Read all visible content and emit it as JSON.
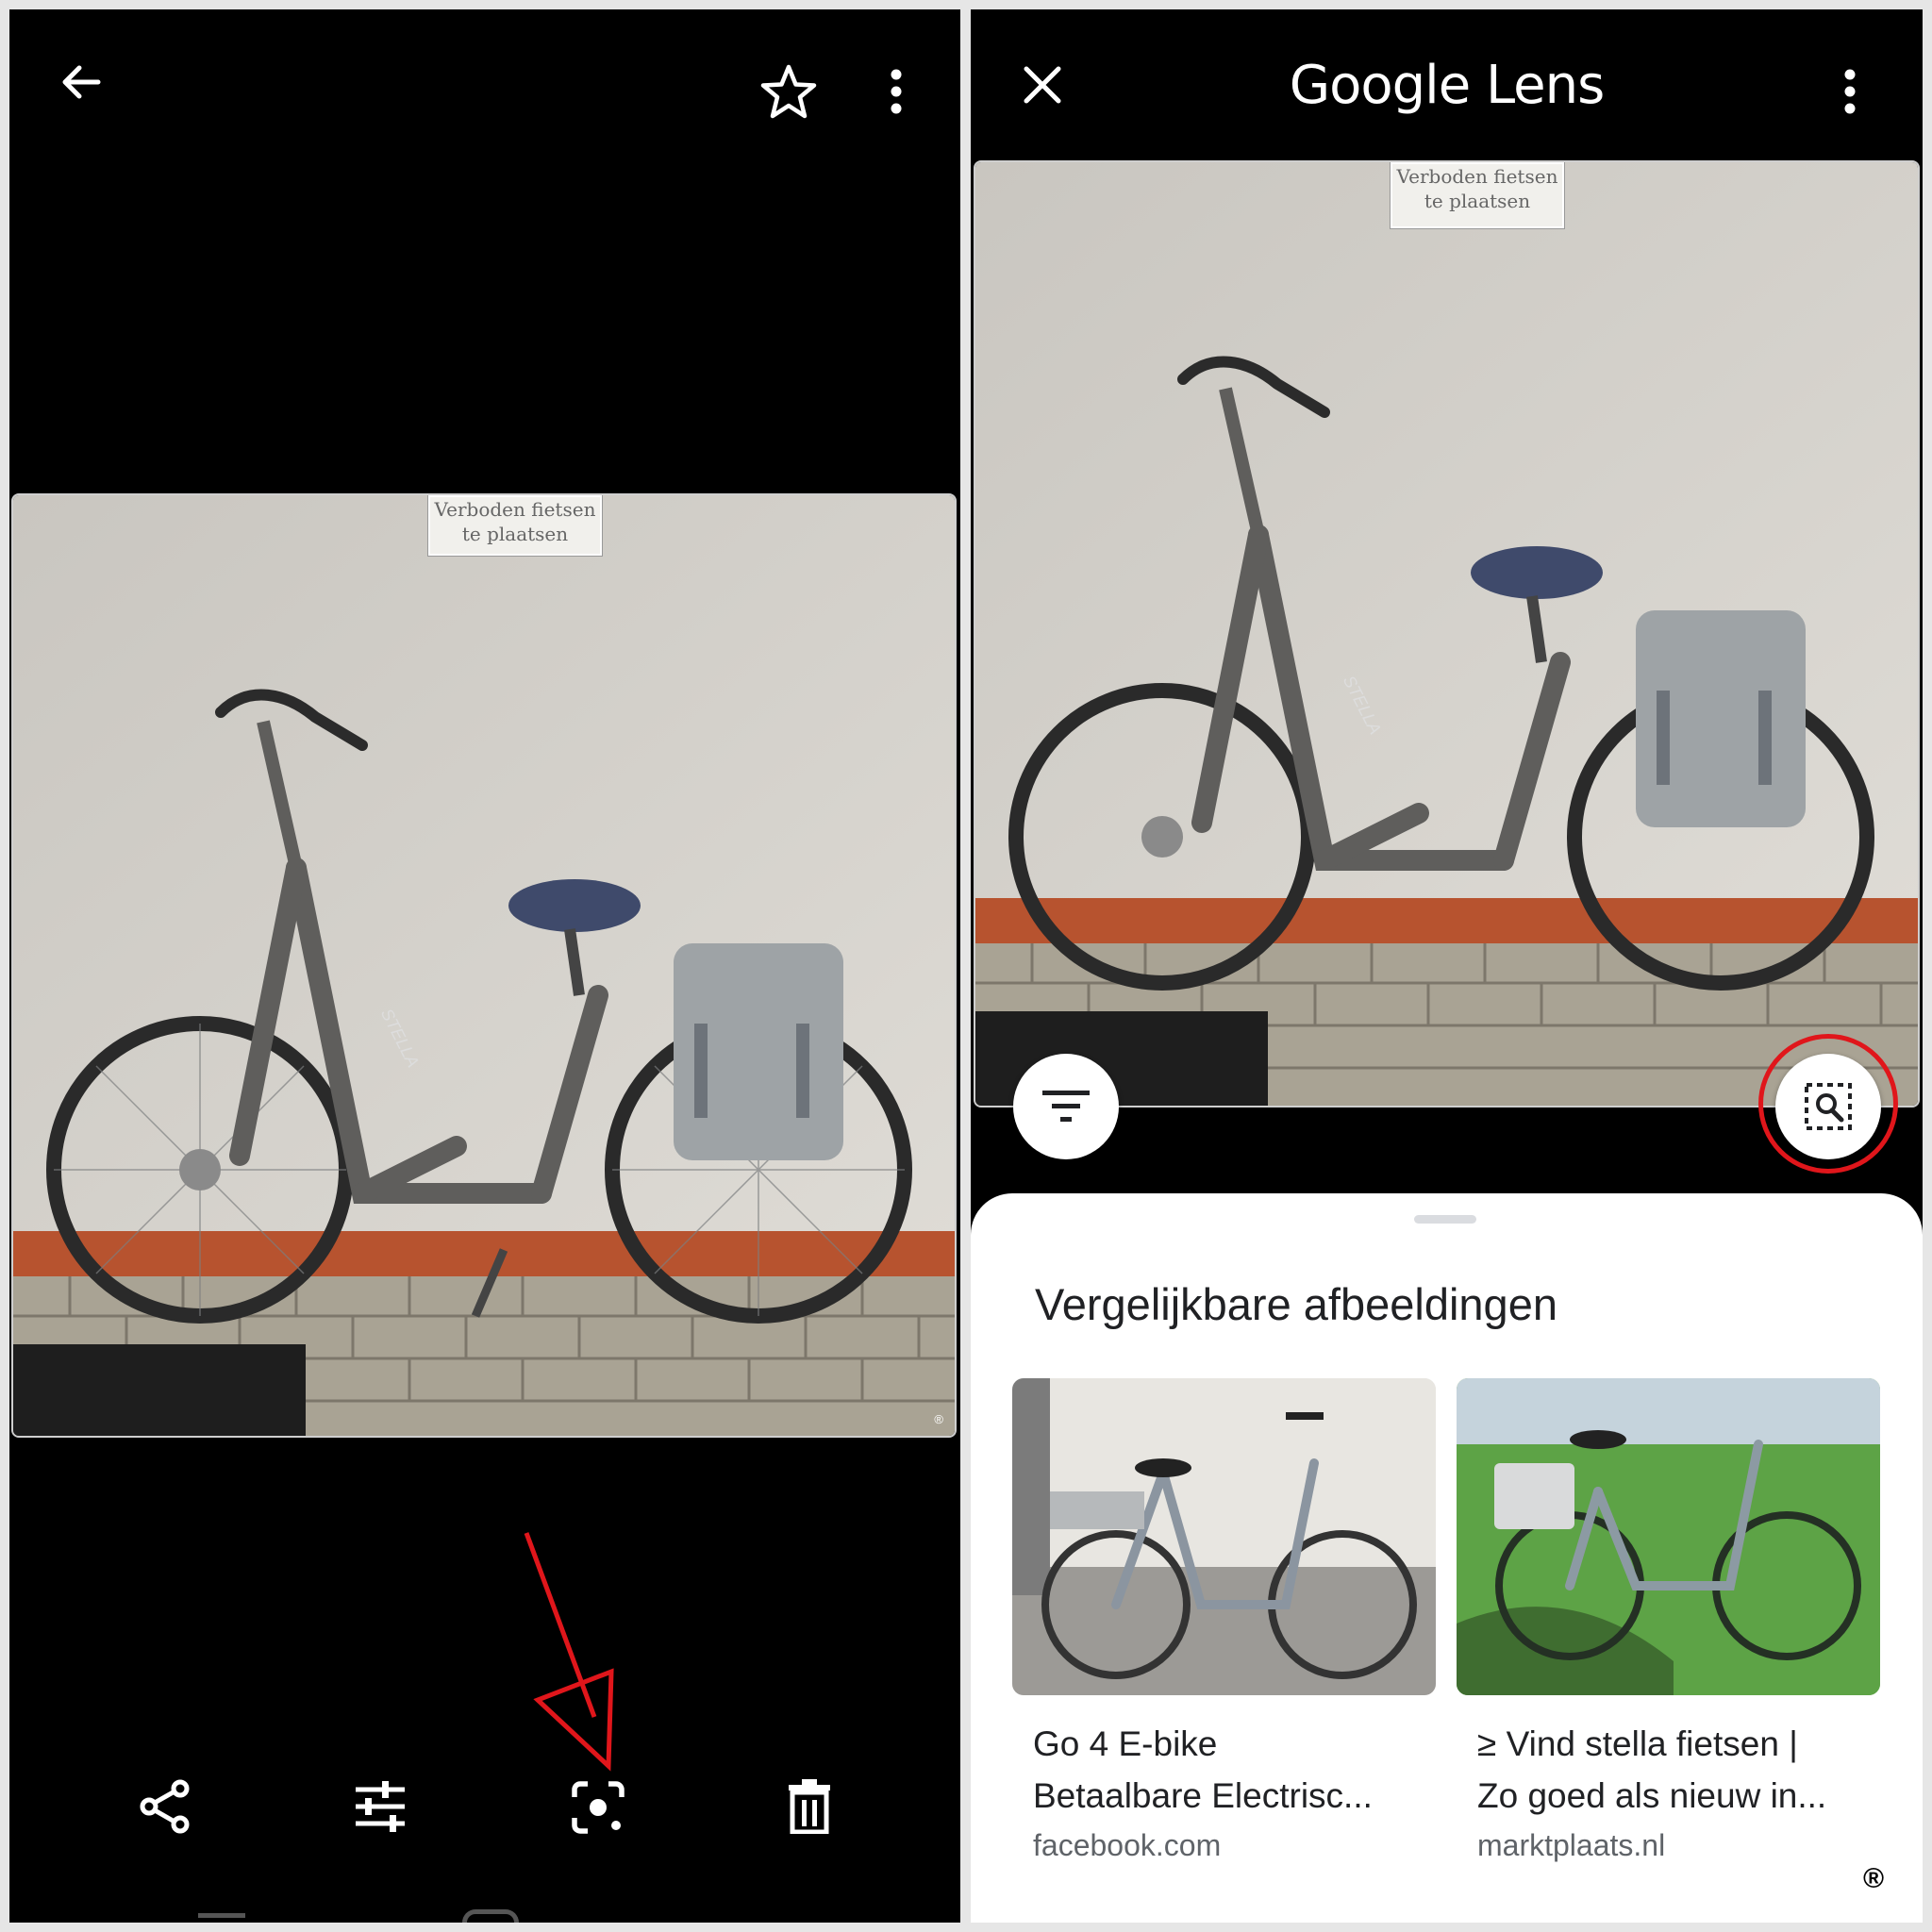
{
  "left_panel": {
    "photo_sign_line1": "Verboden fietsen",
    "photo_sign_line2": "te plaatsen",
    "photo_brand": "STELLA",
    "watermark": "®"
  },
  "right_panel": {
    "app_title": "Google Lens",
    "photo_sign_line1": "Verboden fietsen",
    "photo_sign_line2": "te plaatsen",
    "photo_brand": "STELLA",
    "results": {
      "heading": "Vergelijkbare afbeeldingen",
      "cards": [
        {
          "title_line1": "Go 4 E-bike",
          "title_line2": "Betaalbare Electrisc...",
          "source": "facebook.com"
        },
        {
          "title_line1": "≥ Vind stella fietsen |",
          "title_line2": "Zo goed als nieuw in...",
          "source": "marktplaats.nl"
        }
      ]
    },
    "watermark": "®"
  },
  "colors": {
    "annotation_red": "#e0161b",
    "sheet_bg": "#ffffff",
    "panel_bg": "#000000"
  },
  "icons": [
    "back-arrow-icon",
    "star-icon",
    "more-vert-icon",
    "share-icon",
    "adjust-icon",
    "lens-icon",
    "trash-icon",
    "close-icon",
    "filter-icon",
    "image-search-icon"
  ]
}
